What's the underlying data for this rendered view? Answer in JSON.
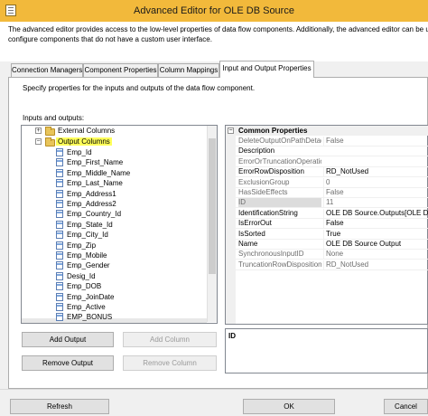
{
  "window": {
    "title": "Advanced Editor for OLE DB Source"
  },
  "description": {
    "line1": "The advanced editor provides access to the low-level properties of data flow components. Additionally, the advanced editor can be used to",
    "line2": "configure components that do not have a custom user interface."
  },
  "tabs": [
    {
      "label": "Connection Managers",
      "active": false
    },
    {
      "label": "Component Properties",
      "active": false
    },
    {
      "label": "Column Mappings",
      "active": false
    },
    {
      "label": "Input and Output Properties",
      "active": true
    }
  ],
  "panel": {
    "description": "Specify properties for the inputs and outputs of the data flow component.",
    "io_label": "Inputs and outputs:"
  },
  "tree": {
    "external_columns": "External Columns",
    "output_columns": "Output Columns",
    "columns": [
      "Emp_Id",
      "Emp_First_Name",
      "Emp_Middle_Name",
      "Emp_Last_Name",
      "Emp_Address1",
      "Emp_Address2",
      "Emp_Country_Id",
      "Emp_State_Id",
      "Emp_City_Id",
      "Emp_Zip",
      "Emp_Mobile",
      "Emp_Gender",
      "Desig_Id",
      "Emp_DOB",
      "Emp_JoinDate",
      "Emp_Active",
      "EMP_BONUS"
    ]
  },
  "buttons": {
    "add_output": "Add Output",
    "add_column": "Add Column",
    "remove_output": "Remove Output",
    "remove_column": "Remove Column",
    "refresh": "Refresh",
    "ok": "OK",
    "cancel": "Cancel"
  },
  "properties": {
    "category": "Common Properties",
    "rows": [
      {
        "name": "DeleteOutputOnPathDetach",
        "value": "False",
        "readonly": true
      },
      {
        "name": "Description",
        "value": "",
        "readonly": false
      },
      {
        "name": "ErrorOrTruncationOperation",
        "value": "",
        "readonly": true
      },
      {
        "name": "ErrorRowDisposition",
        "value": "RD_NotUsed",
        "readonly": false
      },
      {
        "name": "ExclusionGroup",
        "value": "0",
        "readonly": true
      },
      {
        "name": "HasSideEffects",
        "value": "False",
        "readonly": true
      },
      {
        "name": "ID",
        "value": "11",
        "readonly": true
      },
      {
        "name": "IdentificationString",
        "value": "OLE DB Source.Outputs[OLE DB Source",
        "readonly": false
      },
      {
        "name": "IsErrorOut",
        "value": "False",
        "readonly": false
      },
      {
        "name": "IsSorted",
        "value": "True",
        "readonly": false
      },
      {
        "name": "Name",
        "value": "OLE DB Source Output",
        "readonly": false
      },
      {
        "name": "SynchronousInputID",
        "value": "None",
        "readonly": true
      },
      {
        "name": "TruncationRowDisposition",
        "value": "RD_NotUsed",
        "readonly": true
      }
    ],
    "description_title": "ID"
  }
}
